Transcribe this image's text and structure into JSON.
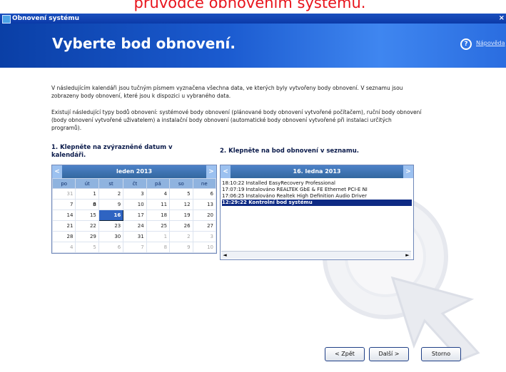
{
  "caption": "průvodce obnovením systému.",
  "window": {
    "title": "Obnovení systému",
    "close": "×"
  },
  "banner": {
    "heading": "Vyberte bod obnovení.",
    "help_label": "Nápověda"
  },
  "description": {
    "para1": "V následujícím kalendáři jsou tučným písmem vyznačena všechna data, ve kterých byly vytvořeny body obnovení. V seznamu jsou zobrazeny body obnovení, které jsou k dispozici u vybraného data.",
    "para2": "Existují následující typy bodů obnovení: systémové body obnovení (plánované body obnovení vytvořené počítačem), ruční body obnovení (body obnovení vytvořené uživatelem) a instalační body obnovení (automatické body obnovení vytvořené při instalaci určitých programů)."
  },
  "step1": {
    "label": "1. Klepněte na zvýrazněné datum v kalendáři."
  },
  "step2": {
    "label": "2. Klepněte na bod obnovení v seznamu."
  },
  "calendar": {
    "month": "leden 2013",
    "prev": "<",
    "next": ">",
    "weekdays": [
      "po",
      "út",
      "st",
      "čt",
      "pá",
      "so",
      "ne"
    ],
    "weeks": [
      [
        "31",
        "1",
        "2",
        "3",
        "4",
        "5",
        "6"
      ],
      [
        "7",
        "8",
        "9",
        "10",
        "11",
        "12",
        "13"
      ],
      [
        "14",
        "15",
        "16",
        "17",
        "18",
        "19",
        "20"
      ],
      [
        "21",
        "22",
        "23",
        "24",
        "25",
        "26",
        "27"
      ],
      [
        "28",
        "29",
        "30",
        "31",
        "1",
        "2",
        "3"
      ],
      [
        "4",
        "5",
        "6",
        "7",
        "8",
        "9",
        "10"
      ]
    ],
    "selected": "16"
  },
  "restore_list": {
    "date": "16. ledna 2013",
    "items": [
      "18:10:22  Installed EasyRecovery Professional",
      "17:07:19  Instalováno REALTEK GbE & FE Ethernet PCI-E NI",
      "17:06:25  Instalováno Realtek High Definition Audio Driver",
      "12:29:22  Kontrolní bod systému"
    ],
    "selected_index": 3
  },
  "buttons": {
    "back": "< Zpět",
    "next": "Další >",
    "cancel": "Storno"
  },
  "colors": {
    "caption": "#e8141c",
    "banner": "#1b5bd0",
    "selection": "#0e2a84"
  }
}
